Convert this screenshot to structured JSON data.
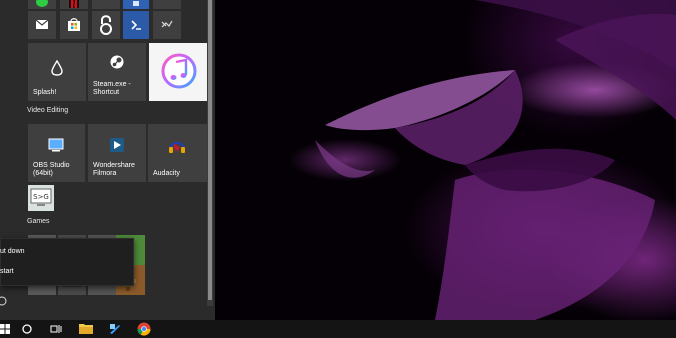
{
  "tiles": {
    "splash_label": "Splash!",
    "steam_label": "Steam.exe - Shortcut",
    "itunes_label": "",
    "obs_label": "OBS Studio (64bit)",
    "filmora_label": "Wondershare Filmora",
    "audacity_label": "Audacity"
  },
  "groups": {
    "video_editing": "Video Editing",
    "games": "Games"
  },
  "power_menu": {
    "shut_down": "ut down",
    "restart": "start"
  },
  "colors": {
    "menu_bg": "#2b2b2b",
    "tile_bg": "#3f3f3f",
    "taskbar_bg": "#141414",
    "itunes_tile_bg": "#f5f5f5"
  }
}
